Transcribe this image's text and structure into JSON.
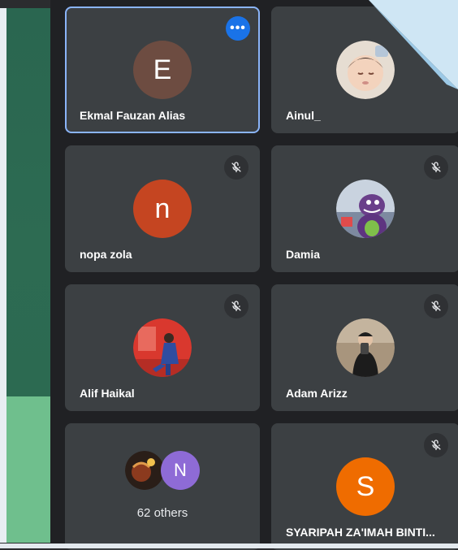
{
  "participants": [
    {
      "name": "Ekmal Fauzan Alias",
      "initial": "E",
      "avatar_color": "#6d4c41",
      "avatar_type": "initial",
      "muted": false,
      "active": true
    },
    {
      "name": "Ainul_",
      "initial": "",
      "avatar_color": "#d9cfc4",
      "avatar_type": "photo",
      "muted": false,
      "active": false
    },
    {
      "name": "nopa zola",
      "initial": "n",
      "avatar_color": "#c54521",
      "avatar_type": "initial",
      "muted": true,
      "active": false
    },
    {
      "name": "Damia",
      "initial": "",
      "avatar_color": "#6a3f8a",
      "avatar_type": "photo",
      "muted": true,
      "active": false
    },
    {
      "name": "Alif Haikal",
      "initial": "",
      "avatar_color": "#d9382e",
      "avatar_type": "photo",
      "muted": true,
      "active": false
    },
    {
      "name": "Adam Arizz",
      "initial": "",
      "avatar_color": "#8a7a66",
      "avatar_type": "photo",
      "muted": true,
      "active": false
    },
    {
      "name": "SYARIPAH ZA'IMAH BINTI...",
      "initial": "S",
      "avatar_color": "#ef6c00",
      "avatar_type": "initial",
      "muted": true,
      "active": false
    }
  ],
  "others_tile": {
    "label": "62 others",
    "avatar_initial": "N",
    "avatar_color": "#8e6bd6"
  },
  "icons": {
    "more": "more-options-icon",
    "mute": "mic-off-icon"
  }
}
